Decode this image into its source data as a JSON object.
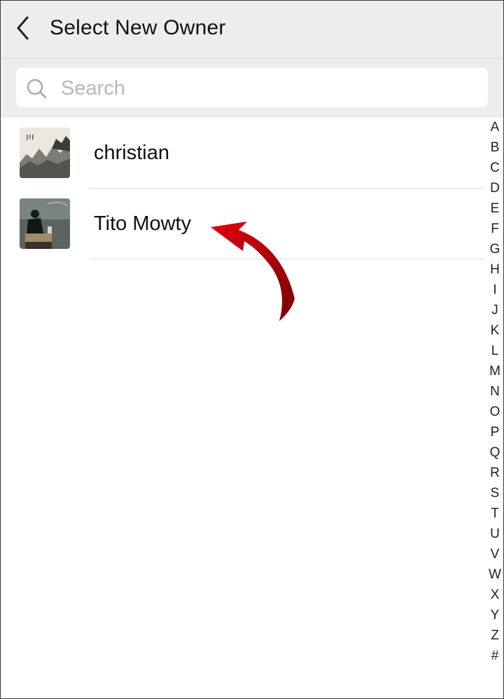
{
  "header": {
    "title": "Select New Owner"
  },
  "search": {
    "placeholder": "Search"
  },
  "contacts": [
    {
      "name": "christian",
      "avatar": "landscape-painting-avatar"
    },
    {
      "name": "Tito Mowty",
      "avatar": "person-photo-avatar"
    }
  ],
  "index_letters": [
    "A",
    "B",
    "C",
    "D",
    "E",
    "F",
    "G",
    "H",
    "I",
    "J",
    "K",
    "L",
    "M",
    "N",
    "O",
    "P",
    "Q",
    "R",
    "S",
    "T",
    "U",
    "V",
    "W",
    "X",
    "Y",
    "Z",
    "#"
  ],
  "colors": {
    "header_bg": "#ededed",
    "arrow": "#c8000a",
    "text": "#111111"
  }
}
